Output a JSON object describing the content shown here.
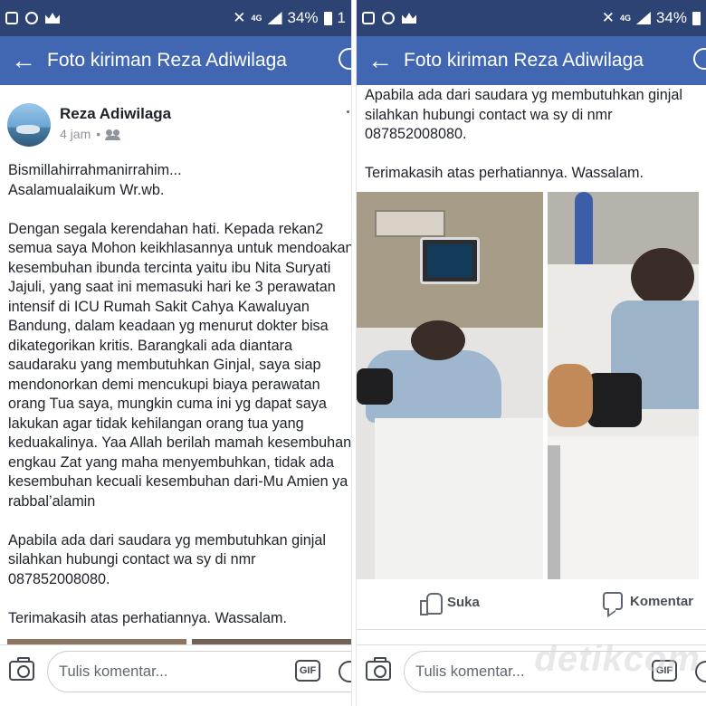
{
  "status_bar": {
    "battery_left": "34%",
    "battery_right": "34%",
    "extra_left": "1",
    "network": "4G"
  },
  "app_bar": {
    "title_left": "Foto kiriman Reza Adiwilaga",
    "title_right": "Foto kiriman Reza Adiwilaga"
  },
  "post": {
    "author": "Reza Adiwilaga",
    "time": "4 jam",
    "separator": "•",
    "body_left": "Bismillahirrahmanirrahim...\nAsalamualaikum Wr.wb.\n\nDengan segala kerendahan hati. Kepada rekan2\nsemua saya Mohon keikhlasannya untuk mendoakan\nkesembuhan ibunda tercinta yaitu ibu Nita Suryati\nJajuli, yang saat ini memasuki hari ke 3 perawatan\nintensif di ICU Rumah Sakit Cahya Kawaluyan\nBandung, dalam keadaan yg menurut dokter bisa\ndikategorikan kritis. Barangkali ada diantara\nsaudaraku yang membutuhkan Ginjal, saya siap\nmendonorkan demi mencukupi biaya perawatan\norang Tua saya, mungkin cuma ini yg dapat saya\nlakukan agar tidak kehilangan orang tua yang\nkeduakalinya. Yaa Allah berilah mamah kesembuhan\nengkau Zat yang maha menyembuhkan, tidak ada\nkesembuhan kecuali kesembuhan dari-Mu Amien ya\nrabbal’alamin\n\nApabila ada dari saudara yg membutuhkan ginjal\nsilahkan hubungi contact wa sy di nmr\n087852008080.\n\nTerimakasih atas perhatiannya. Wassalam.",
    "body_right": "Apabila ada dari saudara yg membutuhkan ginjal\nsilahkan hubungi contact wa sy di nmr\n087852008080.\n\nTerimakasih atas perhatiannya. Wassalam."
  },
  "actions": {
    "like_label": "Suka",
    "comment_label": "Komentar"
  },
  "composer": {
    "placeholder": "Tulis komentar...",
    "gif_label": "GIF"
  },
  "watermark": "detikcom",
  "colors": {
    "status_bar": "#2d4373",
    "app_bar": "#4267b2"
  }
}
